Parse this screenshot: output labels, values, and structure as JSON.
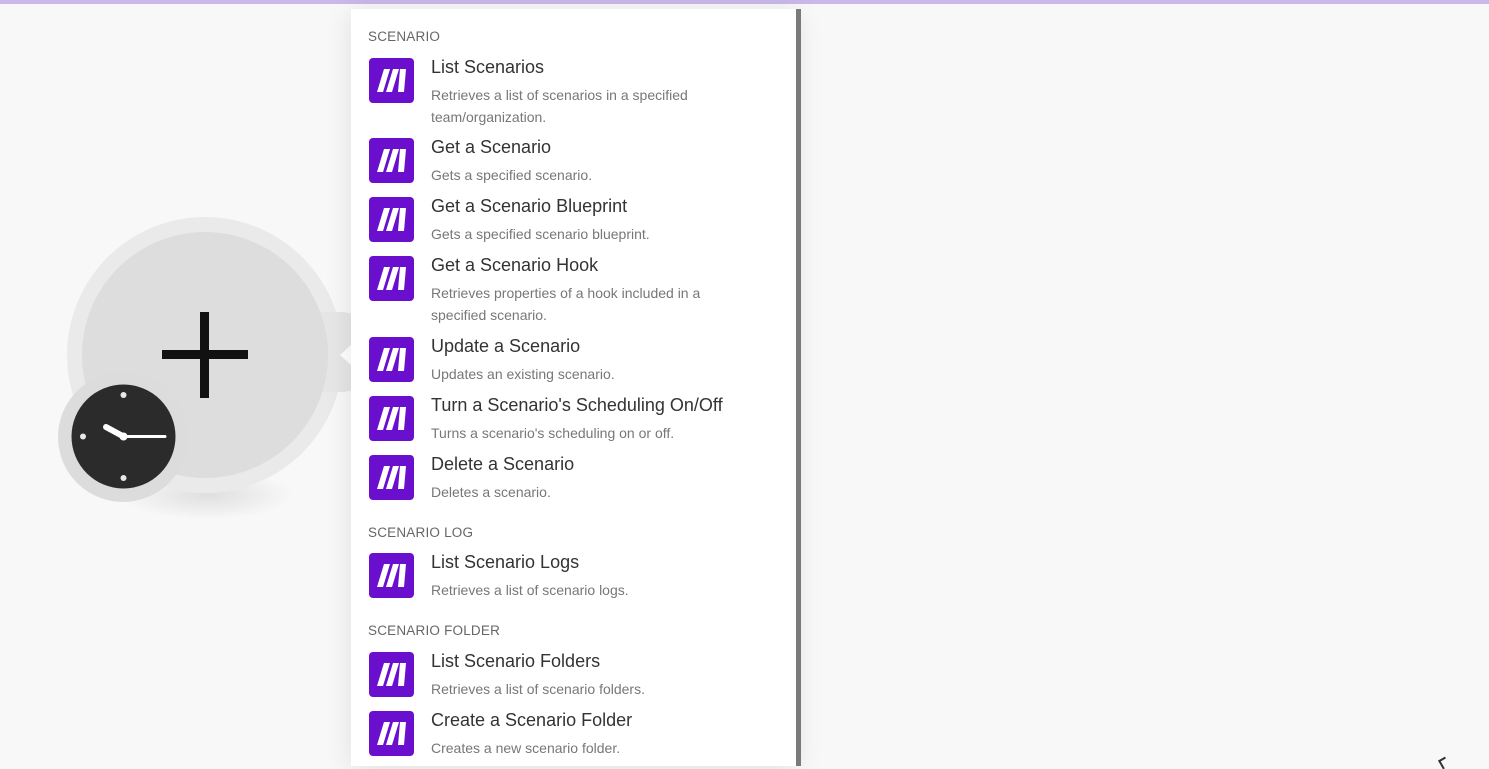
{
  "colors": {
    "accent_bar": "#c9b8e8",
    "app_icon_bg": "#6b0fcf",
    "canvas_bg": "#f8f8f8"
  },
  "canvas": {
    "module_icon": "plus-icon",
    "trigger_badge_icon": "clock-icon"
  },
  "sections": [
    {
      "header": "Scenario",
      "items": [
        {
          "title": "List Scenarios",
          "desc": "Retrieves a list of scenarios in a specified team/organization."
        },
        {
          "title": "Get a Scenario",
          "desc": "Gets a specified scenario."
        },
        {
          "title": "Get a Scenario Blueprint",
          "desc": "Gets a specified scenario blueprint."
        },
        {
          "title": "Get a Scenario Hook",
          "desc": "Retrieves properties of a hook included in a specified scenario."
        },
        {
          "title": "Update a Scenario",
          "desc": "Updates an existing scenario."
        },
        {
          "title": "Turn a Scenario's Scheduling On/Off",
          "desc": "Turns a scenario's scheduling on or off."
        },
        {
          "title": "Delete a Scenario",
          "desc": "Deletes a scenario."
        }
      ]
    },
    {
      "header": "Scenario Log",
      "items": [
        {
          "title": "List Scenario Logs",
          "desc": "Retrieves a list of scenario logs."
        }
      ]
    },
    {
      "header": "Scenario Folder",
      "items": [
        {
          "title": "List Scenario Folders",
          "desc": "Retrieves a list of scenario folders."
        },
        {
          "title": "Create a Scenario Folder",
          "desc": "Creates a new scenario folder."
        }
      ]
    }
  ]
}
